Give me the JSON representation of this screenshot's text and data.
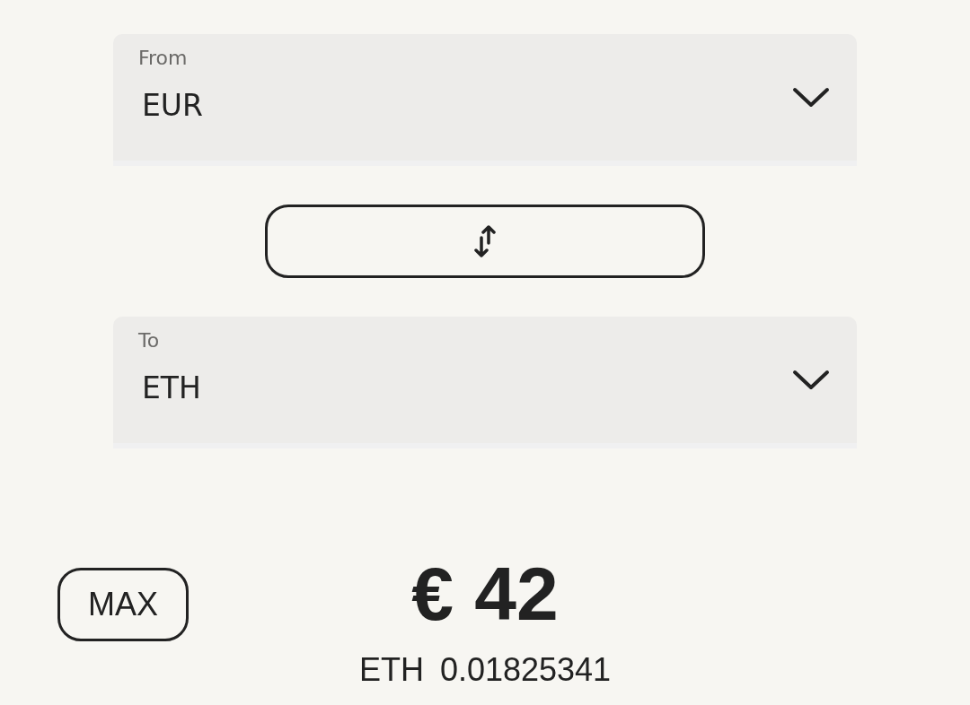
{
  "from": {
    "label": "From",
    "value": "EUR"
  },
  "to": {
    "label": "To",
    "value": "ETH"
  },
  "max_button": "MAX",
  "amount": "€ 42",
  "conversion": {
    "currency": "ETH",
    "value": "0.01825341"
  }
}
